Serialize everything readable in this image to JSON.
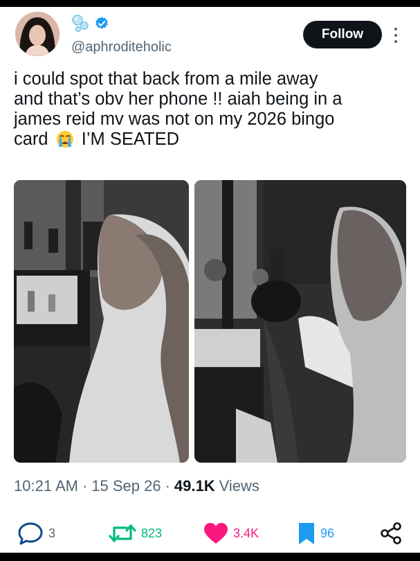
{
  "author": {
    "handle": "@aphroditeholic",
    "verified": true,
    "name_icon": "bubbles-icon"
  },
  "follow_label": "Follow",
  "tweet": {
    "line1": "i could spot that back from a mile away",
    "line2": "and that’s obv her phone !! aiah being in a",
    "line3": "james reid mv was not on my 2026 bingo",
    "line4_before": "card",
    "line4_emoji": "loudly-crying-face",
    "line4_after": "I’M SEATED"
  },
  "meta": {
    "time": "10:21 AM",
    "date": "15 Sep 26",
    "views_count": "49.1K",
    "views_label": "Views"
  },
  "actions": {
    "replies": "3",
    "retweets": "823",
    "likes": "3.4K",
    "bookmarks": "96"
  },
  "colors": {
    "retweet": "#00ba7c",
    "like": "#f91880",
    "bookmark": "#1d9bf0",
    "verified": "#1d9bf0",
    "follow_bg": "#0f1419"
  }
}
